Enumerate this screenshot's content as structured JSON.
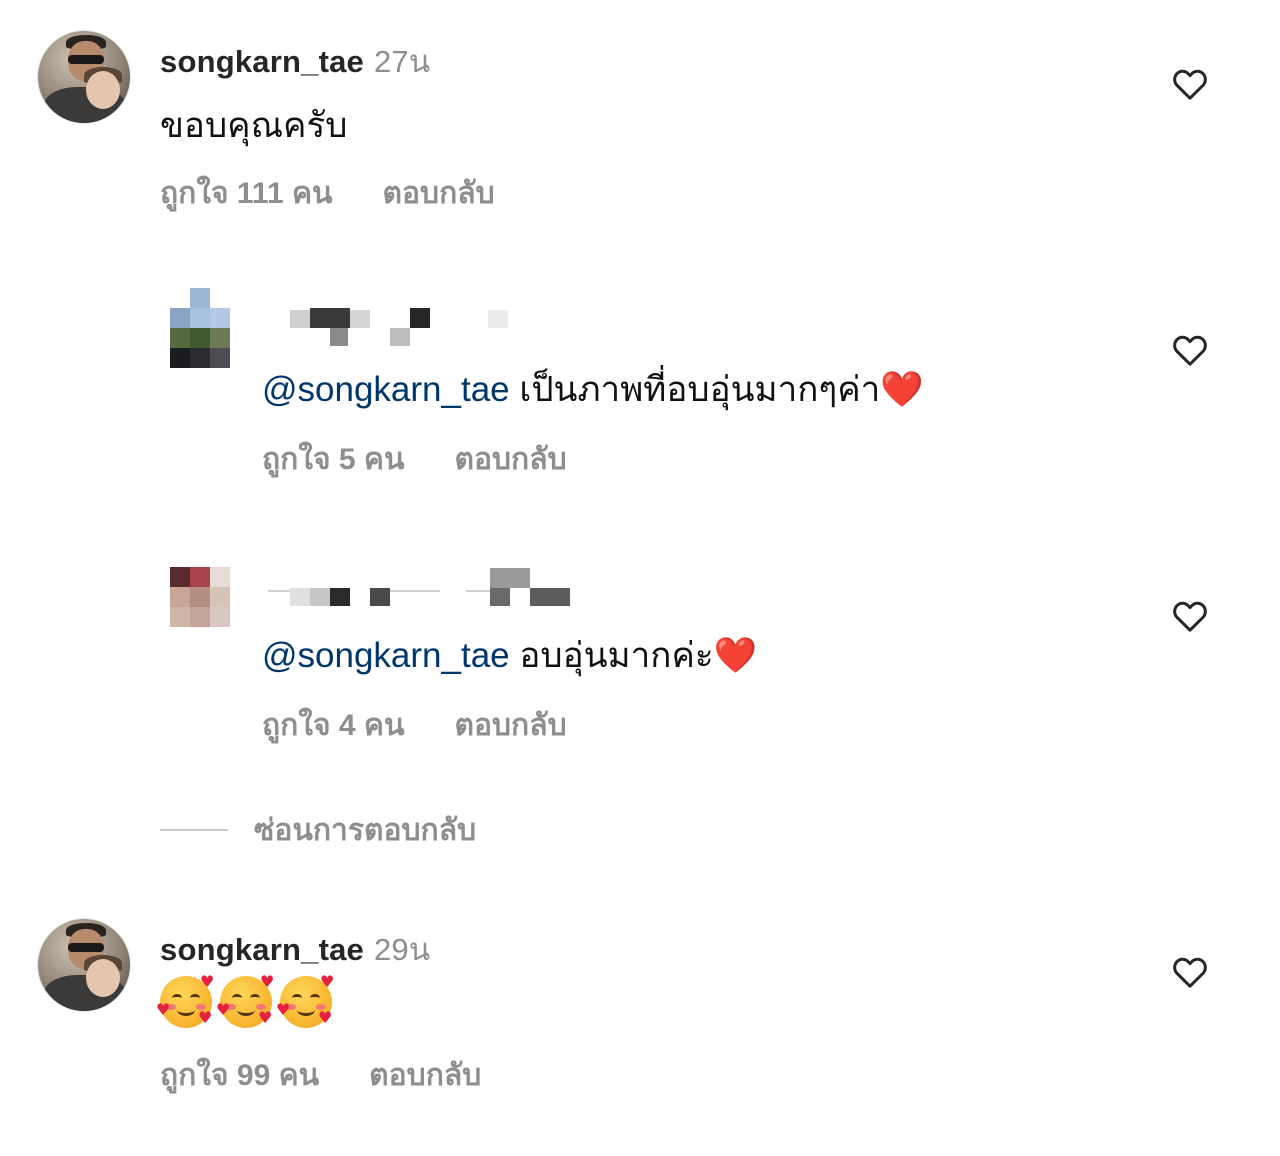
{
  "comments": [
    {
      "username": "songkarn_tae",
      "time": "27น",
      "text": "ขอบคุณครับ",
      "likes": "ถูกใจ 111 คน",
      "reply": "ตอบกลับ"
    },
    {
      "mention": "@songkarn_tae",
      "text": " เป็นภาพที่อบอุ่นมากๆค่า",
      "emoji": "❤️",
      "likes": "ถูกใจ 5 คน",
      "reply": "ตอบกลับ"
    },
    {
      "mention": "@songkarn_tae",
      "text": " อบอุ่นมากค่ะ",
      "emoji": "❤️",
      "likes": "ถูกใจ 4 คน",
      "reply": "ตอบกลับ"
    },
    {
      "username": "songkarn_tae",
      "time": "29น",
      "emoji_text": "🥰🥰🥰",
      "likes": "ถูกใจ 99 คน",
      "reply": "ตอบกลับ"
    }
  ],
  "hide_replies": "ซ่อนการตอบกลับ",
  "icons": {
    "like": "heart-outline-icon",
    "reaction": "smiling-face-with-hearts-icon"
  },
  "colors": {
    "mention": "#00376b",
    "meta": "#8e8e8e",
    "heart": "#e2232a"
  }
}
